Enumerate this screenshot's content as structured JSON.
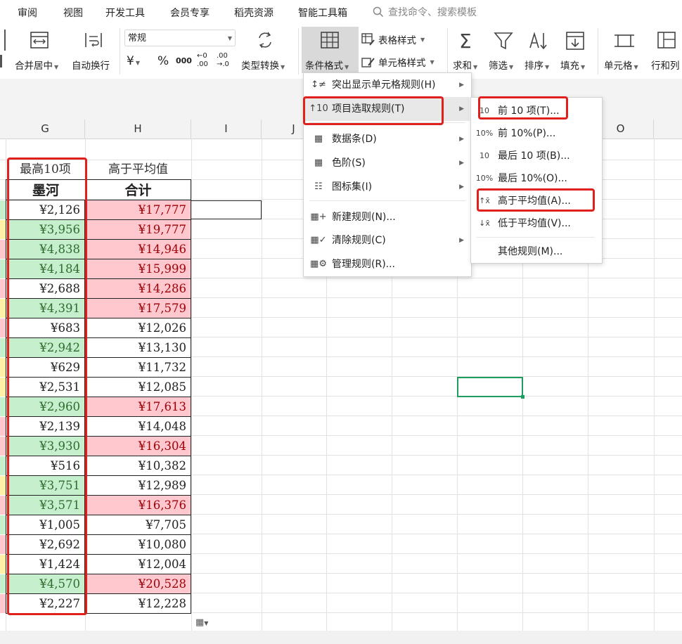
{
  "menubar": {
    "tabs": [
      "审阅",
      "视图",
      "开发工具",
      "会员专享",
      "稻壳资源",
      "智能工具箱"
    ],
    "search_text": "查找命令、搜索模板"
  },
  "ribbon": {
    "merge_center": "合并居中",
    "wrap_text": "自动换行",
    "number_format": "常规",
    "currency_symbol": "¥",
    "percent_symbol": "%",
    "thousand_symbol": "000",
    "dec_inc_top": "←0",
    "dec_inc_bottom": ".00",
    "dec_dec_top": ".00",
    "dec_dec_bottom": "→.0",
    "type_convert": "类型转换",
    "cond_format": "条件格式",
    "table_style": "表格样式",
    "cell_style": "单元格样式",
    "sum": "求和",
    "filter": "筛选",
    "sort": "排序",
    "fill": "填充",
    "cell": "单元格",
    "row_col": "行和列"
  },
  "sheet": {
    "columns": [
      "G",
      "H",
      "I",
      "J",
      "O"
    ],
    "header_g_top": "最高10项",
    "header_h_top": "高于平均值",
    "header_g": "墨河",
    "header_h": "合计",
    "rows": [
      {
        "g": "¥2,126",
        "h": "¥17,777",
        "gs": "w",
        "hs": "r"
      },
      {
        "g": "¥3,956",
        "h": "¥19,777",
        "gs": "g",
        "hs": "r"
      },
      {
        "g": "¥4,838",
        "h": "¥14,946",
        "gs": "g",
        "hs": "r"
      },
      {
        "g": "¥4,184",
        "h": "¥15,999",
        "gs": "g",
        "hs": "r"
      },
      {
        "g": "¥2,688",
        "h": "¥14,286",
        "gs": "w",
        "hs": "r"
      },
      {
        "g": "¥4,391",
        "h": "¥17,579",
        "gs": "g",
        "hs": "r"
      },
      {
        "g": "¥683",
        "h": "¥12,026",
        "gs": "w",
        "hs": "w"
      },
      {
        "g": "¥2,942",
        "h": "¥13,130",
        "gs": "g",
        "hs": "w"
      },
      {
        "g": "¥629",
        "h": "¥11,732",
        "gs": "w",
        "hs": "w"
      },
      {
        "g": "¥2,531",
        "h": "¥12,085",
        "gs": "w",
        "hs": "w"
      },
      {
        "g": "¥2,960",
        "h": "¥17,613",
        "gs": "g",
        "hs": "r"
      },
      {
        "g": "¥2,139",
        "h": "¥14,048",
        "gs": "w",
        "hs": "w"
      },
      {
        "g": "¥3,930",
        "h": "¥16,304",
        "gs": "g",
        "hs": "r"
      },
      {
        "g": "¥516",
        "h": "¥10,382",
        "gs": "w",
        "hs": "w"
      },
      {
        "g": "¥3,751",
        "h": "¥12,989",
        "gs": "g",
        "hs": "w"
      },
      {
        "g": "¥3,571",
        "h": "¥16,376",
        "gs": "g",
        "hs": "r"
      },
      {
        "g": "¥1,005",
        "h": "¥7,705",
        "gs": "w",
        "hs": "w"
      },
      {
        "g": "¥2,692",
        "h": "¥10,080",
        "gs": "w",
        "hs": "w"
      },
      {
        "g": "¥1,424",
        "h": "¥12,004",
        "gs": "w",
        "hs": "w"
      },
      {
        "g": "¥4,570",
        "h": "¥20,528",
        "gs": "g",
        "hs": "r"
      },
      {
        "g": "¥2,227",
        "h": "¥12,228",
        "gs": "w",
        "hs": "w"
      }
    ],
    "stub_colors": [
      "#c6efce",
      "#fff2a8",
      "#ffc7ce",
      "#c6efce",
      "#ffc7ce",
      "#fff2a8",
      "#ffc7ce",
      "#c6efce",
      "#fff2a8",
      "#fff2a8",
      "#c6efce",
      "#ffc7ce",
      "#ffc7ce",
      "#c6efce",
      "#fff2a8",
      "#ffc7ce",
      "#c6efce",
      "#ffc7ce",
      "#fff2a8",
      "#c6efce",
      "#ffc7ce"
    ]
  },
  "cond_menu": {
    "items": [
      {
        "label": "突出显示单元格规则(H)",
        "icon": "highlight-rule-icon",
        "arrow": true
      },
      {
        "label": "项目选取规则(T)",
        "icon": "top-bottom-rule-icon",
        "arrow": true
      },
      {
        "label": "数据条(D)",
        "icon": "data-bar-icon",
        "arrow": true
      },
      {
        "label": "色阶(S)",
        "icon": "color-scale-icon",
        "arrow": true
      },
      {
        "label": "图标集(I)",
        "icon": "icon-set-icon",
        "arrow": true
      },
      {
        "label": "新建规则(N)...",
        "icon": "new-rule-icon",
        "arrow": false
      },
      {
        "label": "清除规则(C)",
        "icon": "clear-rule-icon",
        "arrow": true
      },
      {
        "label": "管理规则(R)...",
        "icon": "manage-rule-icon",
        "arrow": false
      }
    ]
  },
  "sub_menu": {
    "items": [
      {
        "label": "前 10 项(T)...",
        "icon_text": "10"
      },
      {
        "label": "前 10%(P)...",
        "icon_text": "10%"
      },
      {
        "label": "最后 10 项(B)...",
        "icon_text": "10"
      },
      {
        "label": "最后 10%(O)...",
        "icon_text": "10%"
      },
      {
        "label": "高于平均值(A)...",
        "icon_text": "↑x̄"
      },
      {
        "label": "低于平均值(V)...",
        "icon_text": "↓x̄"
      },
      {
        "label": "其他规则(M)...",
        "icon_text": ""
      }
    ]
  }
}
